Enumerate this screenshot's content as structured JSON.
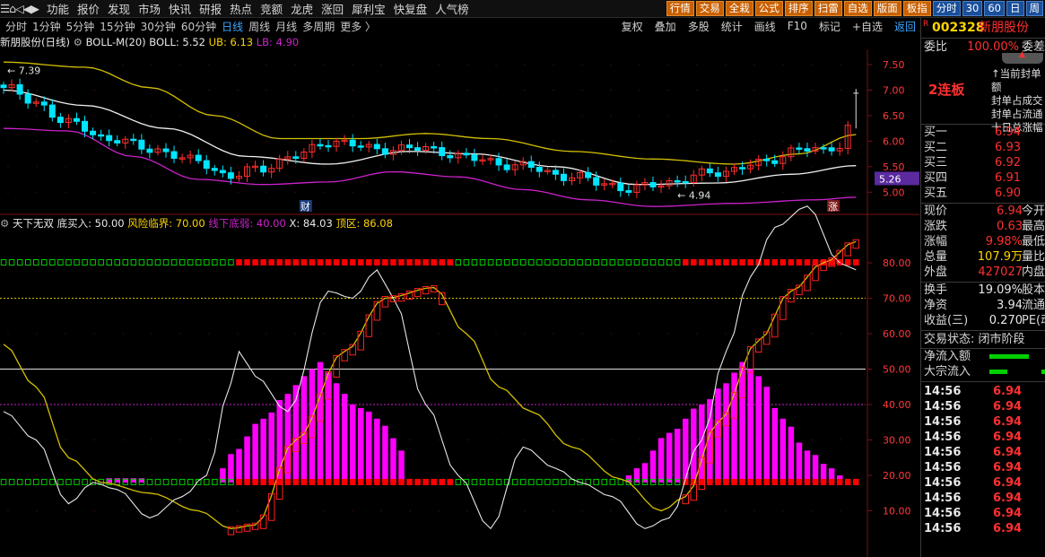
{
  "topbar": {
    "logo": "☰⌂◁◀▶",
    "menu": [
      "功能",
      "报价",
      "发现",
      "市场",
      "快讯",
      "研报",
      "热点",
      "竞额",
      "龙虎",
      "涨回",
      "犀利宝",
      "快复盘",
      "人气榜"
    ],
    "buttons": [
      "行情",
      "交易",
      "全栽",
      "公式",
      "排序",
      "扫雷",
      "自选",
      "版面",
      "板指",
      "分时",
      "30",
      "60",
      "日",
      "周"
    ]
  },
  "periods": [
    "分时",
    "1分钟",
    "5分钟",
    "15分钟",
    "30分钟",
    "60分钟",
    "日线",
    "周线",
    "月线",
    "多周期",
    "更多 〉"
  ],
  "period_active": "日线",
  "tools": [
    "复权",
    "叠加",
    "多股",
    "统计",
    "画线",
    "F10",
    "标记",
    "+自选",
    "返回"
  ],
  "main_legend": {
    "stock": "新朋股份(日线)",
    "indicator": "BOLL-M(20)",
    "boll": "BOLL: 5.52",
    "ub": "UB: 6.13",
    "lb": "LB: 4.90"
  },
  "sub_legend": {
    "name": "天下无双",
    "t1": "底买入: 50.00",
    "t2": "风险临界: 70.00",
    "t3": "线下底弱: 40.00",
    "t4": "X: 84.03",
    "t5": "顶区: 86.08"
  },
  "chart_labels": {
    "hi_label": "7.39",
    "lo_label": "4.94",
    "price_tag": "5.26",
    "cai": "财",
    "zhang": "涨"
  },
  "main_axis": [
    "7.50",
    "7.00",
    "6.50",
    "6.00",
    "5.50",
    "5.00"
  ],
  "sub_axis": [
    "80.00",
    "70.00",
    "60.00",
    "50.00",
    "40.00",
    "30.00",
    "20.00",
    "10.00"
  ],
  "colors": {
    "up": "#ff2d2d",
    "down": "#00e5ff",
    "mid": "#f0f0f0",
    "upper": "#d4c000",
    "lower": "#cc22cc",
    "green_box": "#00cc00",
    "red_box": "#ff0000",
    "magenta": "#ff00ff",
    "tag_bg": "#5a2a9e"
  },
  "right_panel": {
    "code": "002328",
    "name": "新朋股份",
    "weibi_label": "委比",
    "weibi_val": "100.00%",
    "weicha_label": "委差",
    "lianban": "2连板",
    "seal_lines": [
      "↑当前封单额",
      "封单占成交",
      "封单占流通",
      "十日总涨幅"
    ],
    "bids": [
      {
        "label": "买一",
        "price": "6.94"
      },
      {
        "label": "买二",
        "price": "6.93"
      },
      {
        "label": "买三",
        "price": "6.92"
      },
      {
        "label": "买四",
        "price": "6.91"
      },
      {
        "label": "买五",
        "price": "6.90"
      }
    ],
    "quote": [
      {
        "label": "现价",
        "val": "6.94",
        "tail": "今开"
      },
      {
        "label": "涨跌",
        "val": "0.63",
        "tail": "最高"
      },
      {
        "label": "涨幅",
        "val": "9.98%",
        "tail": "最低"
      },
      {
        "label": "总量",
        "val": "107.9万",
        "tail": "量比"
      },
      {
        "label": "外盘",
        "val": "427027",
        "tail": "内盘"
      }
    ],
    "stats": [
      {
        "label": "换手",
        "val": "19.09%",
        "tail": "股本"
      },
      {
        "label": "净资",
        "val": "3.94",
        "tail": "流通"
      },
      {
        "label": "收益(三)",
        "val": "0.270",
        "tail": "PE(动"
      }
    ],
    "status": "交易状态: 闭市阶段",
    "flows": [
      {
        "label": "净流入额"
      },
      {
        "label": "大宗流入"
      }
    ],
    "ticks": [
      {
        "time": "14:56",
        "price": "6.94"
      },
      {
        "time": "14:56",
        "price": "6.94"
      },
      {
        "time": "14:56",
        "price": "6.94"
      },
      {
        "time": "14:56",
        "price": "6.94"
      },
      {
        "time": "14:56",
        "price": "6.94"
      },
      {
        "time": "14:56",
        "price": "6.94"
      },
      {
        "time": "14:56",
        "price": "6.94"
      },
      {
        "time": "14:56",
        "price": "6.94"
      },
      {
        "time": "14:56",
        "price": "6.94"
      },
      {
        "time": "14:56",
        "price": "6.94"
      }
    ]
  },
  "chart_data": [
    {
      "type": "candlestick",
      "title": "新朋股份(日线)",
      "ylim": [
        4.6,
        7.8
      ],
      "n_candles": 106,
      "boll": {
        "mid": 5.52,
        "ub": 6.13,
        "lb": 4.9
      },
      "labels": {
        "high": 7.39,
        "low": 4.94
      }
    },
    {
      "type": "bar",
      "title": "天下无双",
      "ylim": [
        0,
        100
      ],
      "levels": {
        "底买入": 50.0,
        "风险临界": 70.0,
        "线下底弱": 40.0,
        "X": 84.03,
        "顶区": 86.08
      }
    }
  ]
}
